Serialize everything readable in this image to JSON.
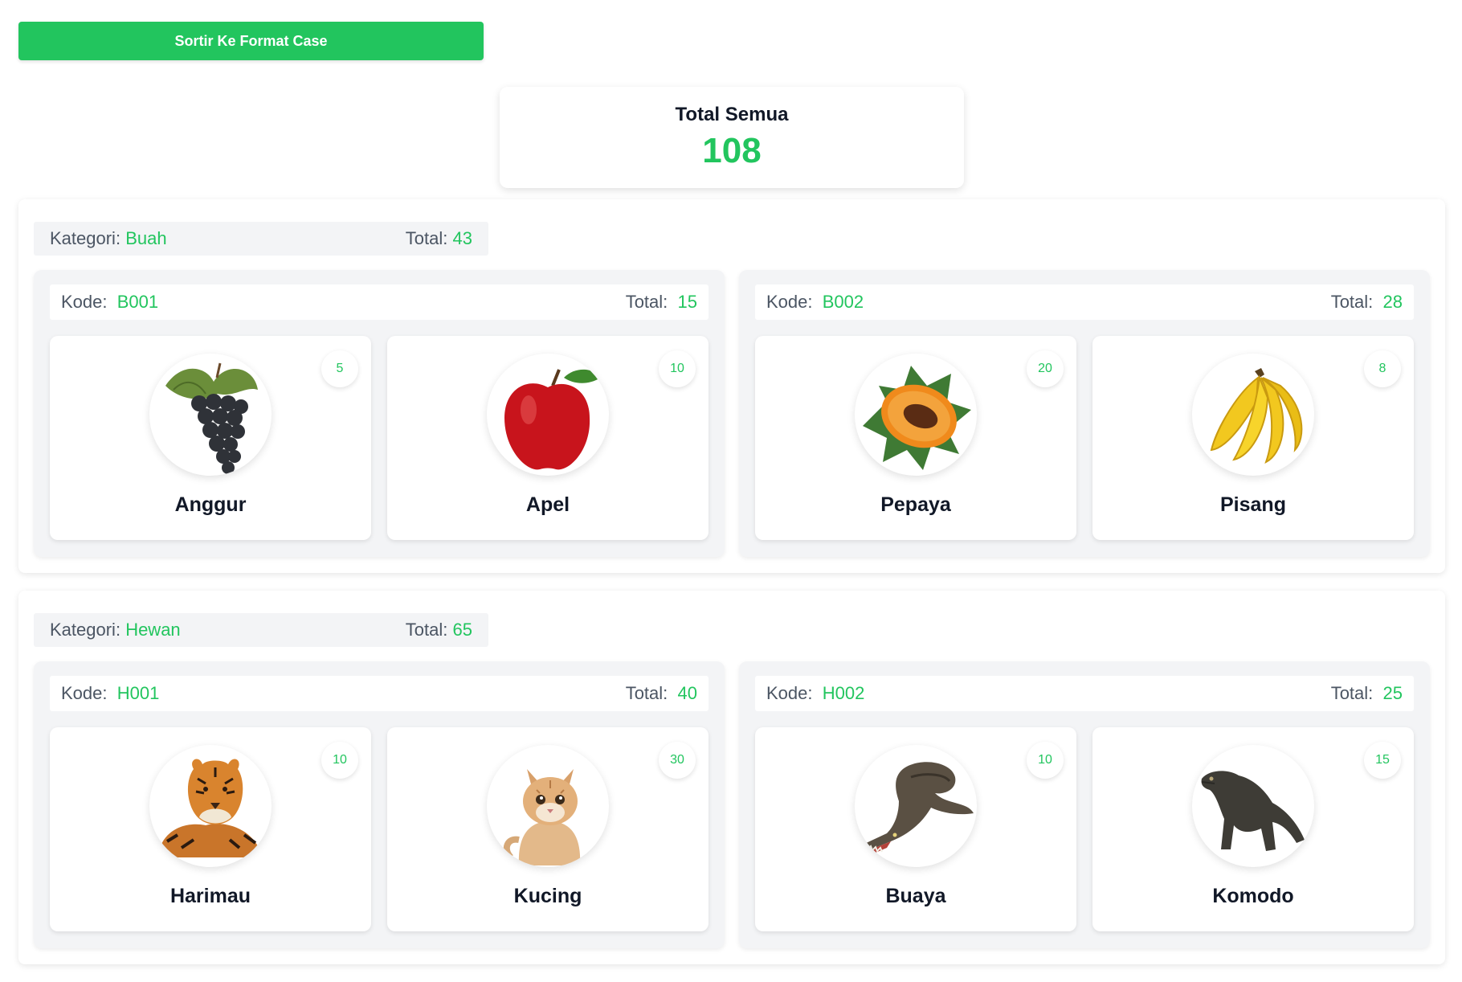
{
  "sort_button": {
    "label": "Sortir Ke Format Case"
  },
  "grand_total": {
    "label": "Total Semua",
    "value": "108"
  },
  "categories": [
    {
      "label": "Kategori:",
      "name": "Buah",
      "total_label": "Total:",
      "total": "43",
      "groups": [
        {
          "code_label": "Kode:",
          "code": "B001",
          "total_label": "Total:",
          "total": "15",
          "items": [
            {
              "name": "Anggur",
              "count": "5",
              "icon": "grapes-icon"
            },
            {
              "name": "Apel",
              "count": "10",
              "icon": "apple-icon"
            }
          ]
        },
        {
          "code_label": "Kode:",
          "code": "B002",
          "total_label": "Total:",
          "total": "28",
          "items": [
            {
              "name": "Pepaya",
              "count": "20",
              "icon": "papaya-icon"
            },
            {
              "name": "Pisang",
              "count": "8",
              "icon": "banana-icon"
            }
          ]
        }
      ]
    },
    {
      "label": "Kategori:",
      "name": "Hewan",
      "total_label": "Total:",
      "total": "65",
      "groups": [
        {
          "code_label": "Kode:",
          "code": "H001",
          "total_label": "Total:",
          "total": "40",
          "items": [
            {
              "name": "Harimau",
              "count": "10",
              "icon": "tiger-icon"
            },
            {
              "name": "Kucing",
              "count": "30",
              "icon": "cat-icon"
            }
          ]
        },
        {
          "code_label": "Kode:",
          "code": "H002",
          "total_label": "Total:",
          "total": "25",
          "items": [
            {
              "name": "Buaya",
              "count": "10",
              "icon": "crocodile-icon"
            },
            {
              "name": "Komodo",
              "count": "15",
              "icon": "komodo-icon"
            }
          ]
        }
      ]
    }
  ],
  "colors": {
    "accent": "#22c55e",
    "panel": "#f3f4f6",
    "text": "#111827",
    "muted": "#4b5563"
  }
}
